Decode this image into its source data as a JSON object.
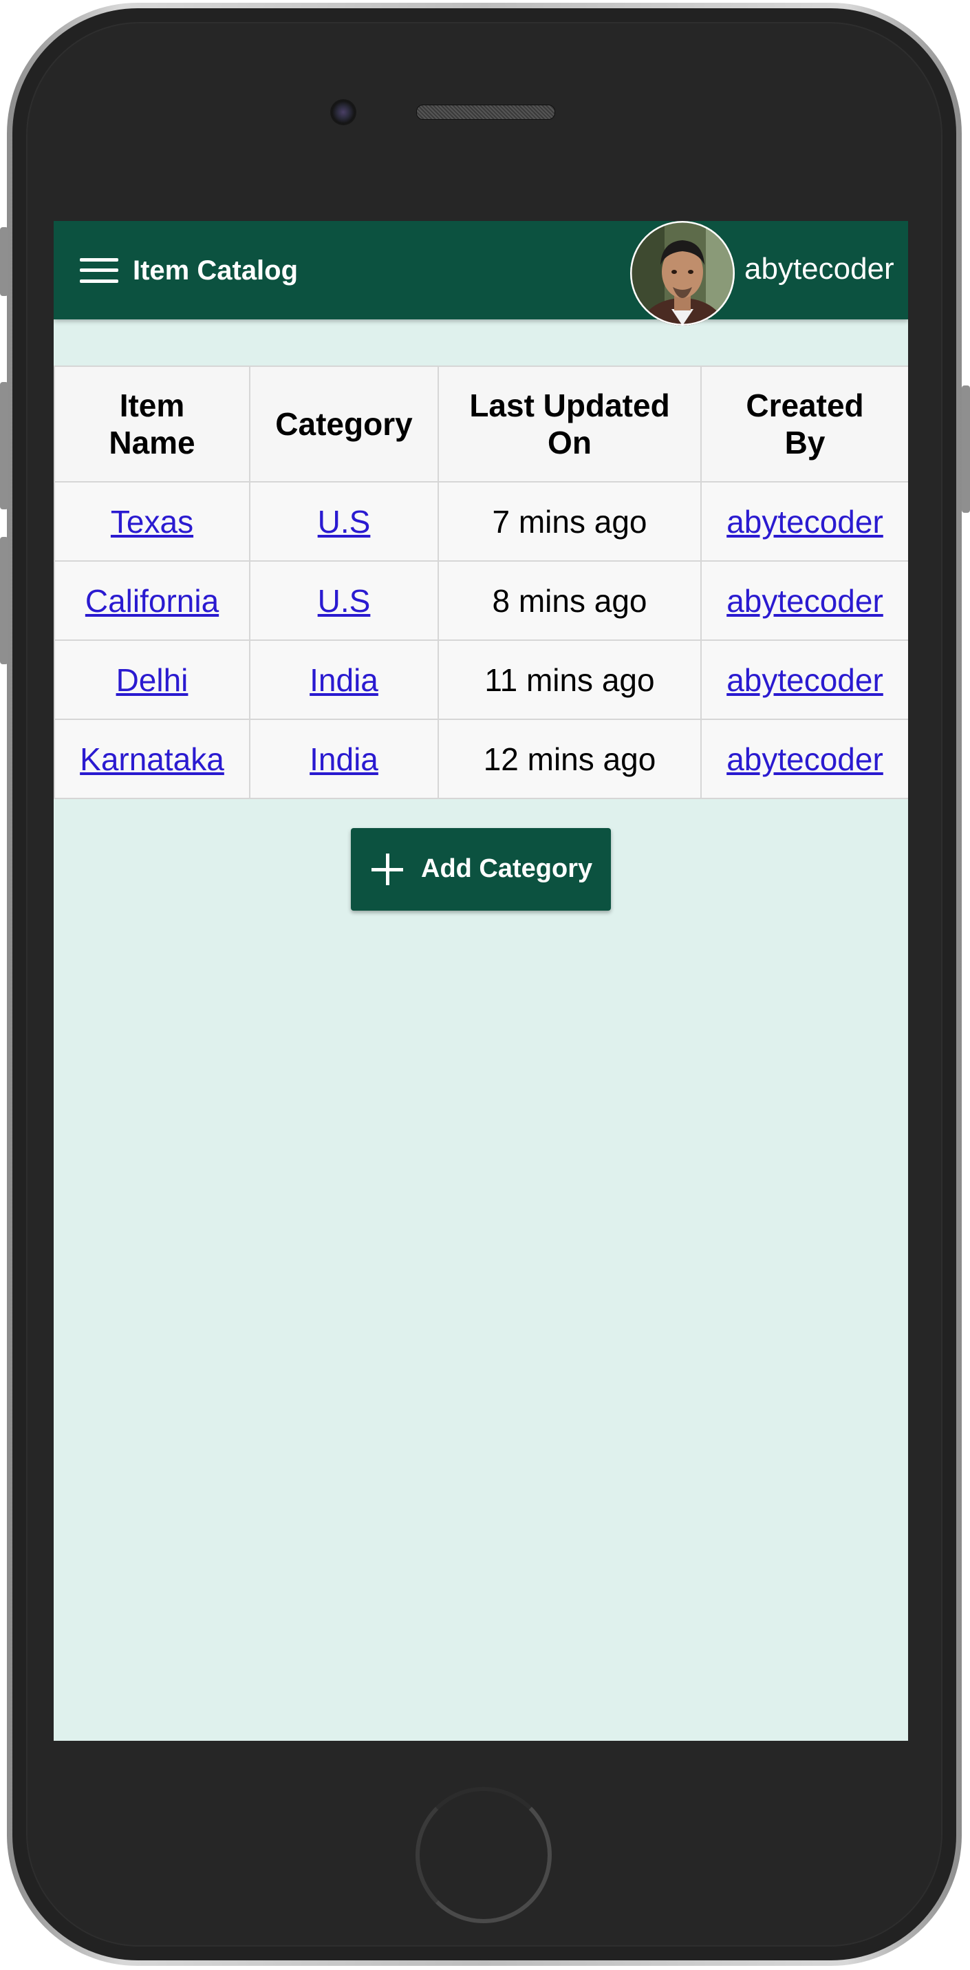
{
  "app": {
    "title": "Item Catalog",
    "username": "abytecoder",
    "menu_icon": "hamburger-menu-icon",
    "avatar": "user-avatar-photo"
  },
  "table": {
    "headers": [
      "Item Name",
      "Category",
      "Last Updated On",
      "Created By"
    ],
    "rows": [
      {
        "item": "Texas",
        "category": "U.S",
        "updated": "7 mins ago",
        "created_by": "abytecoder"
      },
      {
        "item": "California",
        "category": "U.S",
        "updated": "8 mins ago",
        "created_by": "abytecoder"
      },
      {
        "item": "Delhi",
        "category": "India",
        "updated": "11 mins ago",
        "created_by": "abytecoder"
      },
      {
        "item": "Karnataka",
        "category": "India",
        "updated": "12 mins ago",
        "created_by": "abytecoder"
      }
    ]
  },
  "actions": {
    "add_category_label": "Add Category",
    "add_icon": "plus-icon"
  },
  "colors": {
    "primary": "#0c5240",
    "background": "#dff1ed",
    "link": "#2a1ad0"
  }
}
